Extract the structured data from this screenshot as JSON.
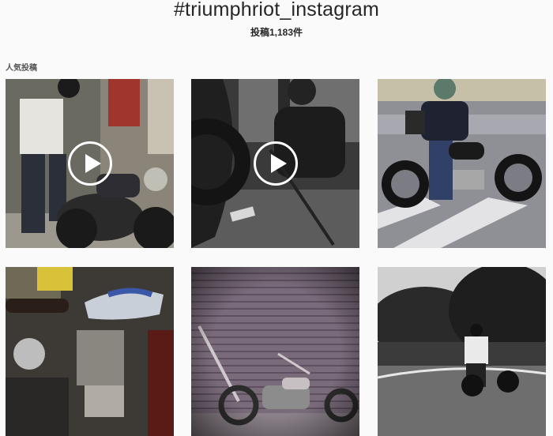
{
  "header": {
    "hashtag": "#triumphriot_instagram",
    "post_count": "投稿1,183件"
  },
  "top_posts": {
    "title": "人気投稿",
    "items": [
      {
        "type": "video",
        "description_icon": "motorcycle-rider"
      },
      {
        "type": "video",
        "description_icon": "mechanic-garage"
      },
      {
        "type": "image",
        "description_icon": "motorcycle-rider"
      },
      {
        "type": "image",
        "description_icon": "triumph-tank"
      },
      {
        "type": "image",
        "description_icon": "chopper-motorcycle"
      },
      {
        "type": "image",
        "description_icon": "motorcycle-road"
      }
    ]
  },
  "colors": {
    "background": "#fafafa",
    "text": "#262626"
  }
}
